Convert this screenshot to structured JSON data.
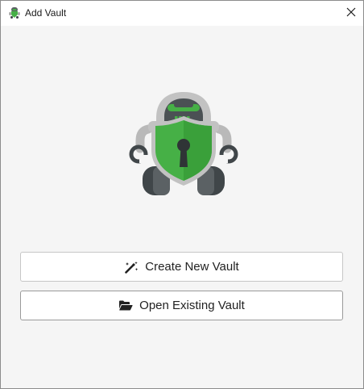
{
  "window": {
    "title": "Add Vault",
    "app_icon": "cryptomator-robot-icon",
    "close_icon": "close-icon"
  },
  "logo": {
    "icon": "cryptomator-robot-logo",
    "colors": {
      "shield": "#46b046",
      "shield_dark": "#3a9a3a",
      "body_gray": "#b8b8b8",
      "dark": "#404649"
    }
  },
  "actions": {
    "create": {
      "label": "Create New Vault",
      "icon": "magic-wand-icon"
    },
    "open": {
      "label": "Open Existing Vault",
      "icon": "folder-open-icon"
    }
  }
}
